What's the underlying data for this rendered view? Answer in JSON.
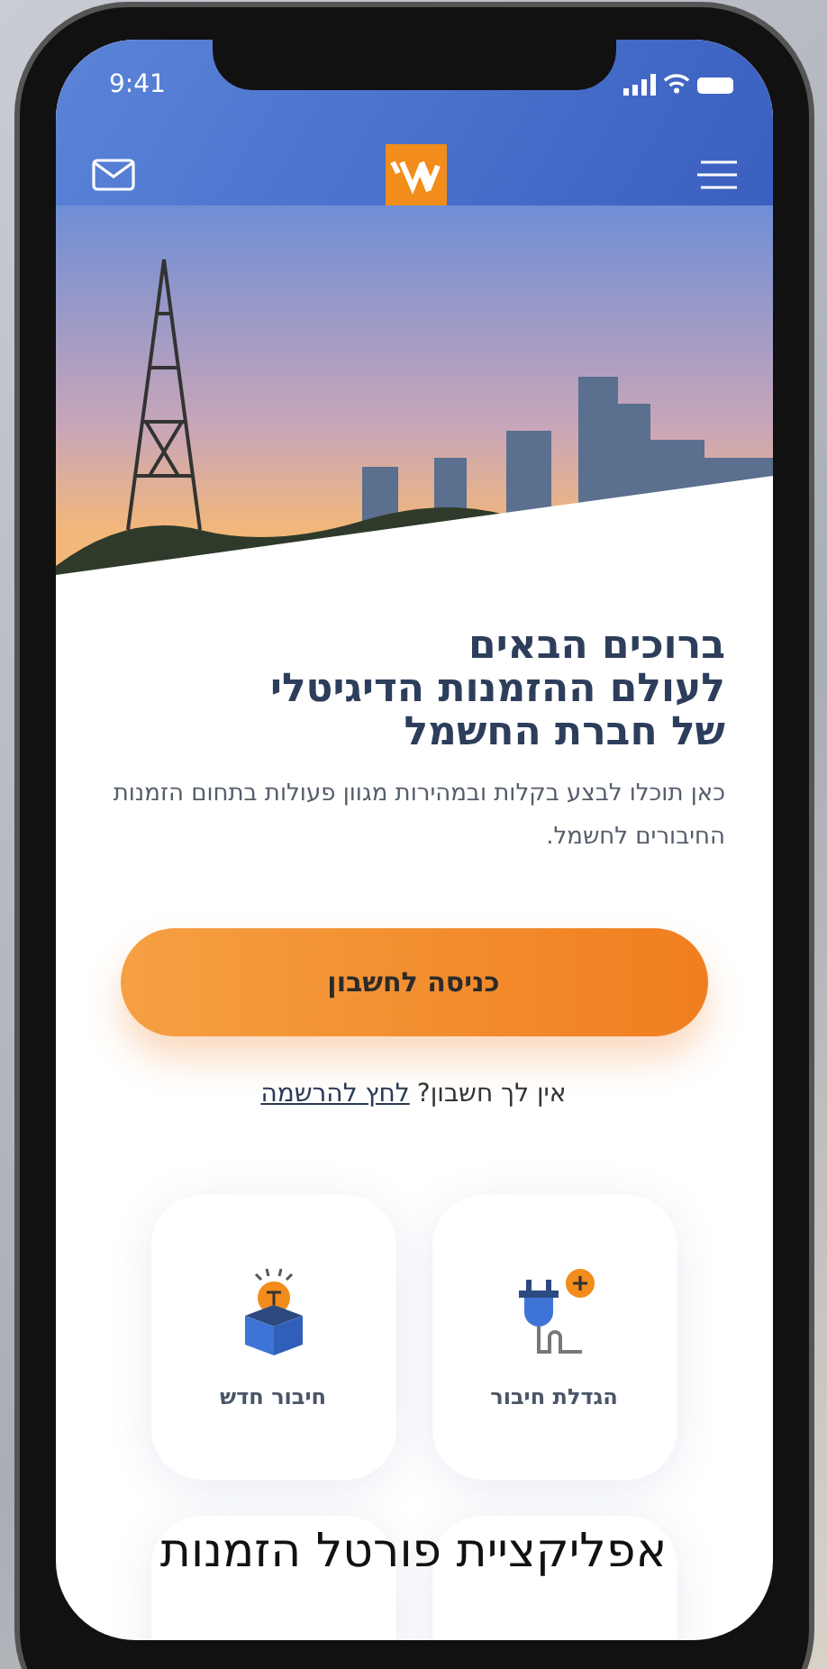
{
  "status_bar": {
    "time": "9:41"
  },
  "welcome": {
    "title_lines": [
      "ברוכים הבאים",
      "לעולם ההזמנות הדיגיטלי",
      "של חברת החשמל"
    ],
    "description": "כאן תוכלו לבצע בקלות ובמהירות מגוון פעולות בתחום הזמנות החיבורים לחשמל."
  },
  "login_button": {
    "label": "כניסה לחשבון"
  },
  "signup": {
    "prompt": "אין לך חשבון?",
    "link": "לחץ להרשמה"
  },
  "services": [
    {
      "kind": "plug",
      "label": "הגדלת חיבור"
    },
    {
      "kind": "bulb-box",
      "label": "חיבור חדש"
    }
  ],
  "caption": "אפליקציית פורטל הזמנות"
}
